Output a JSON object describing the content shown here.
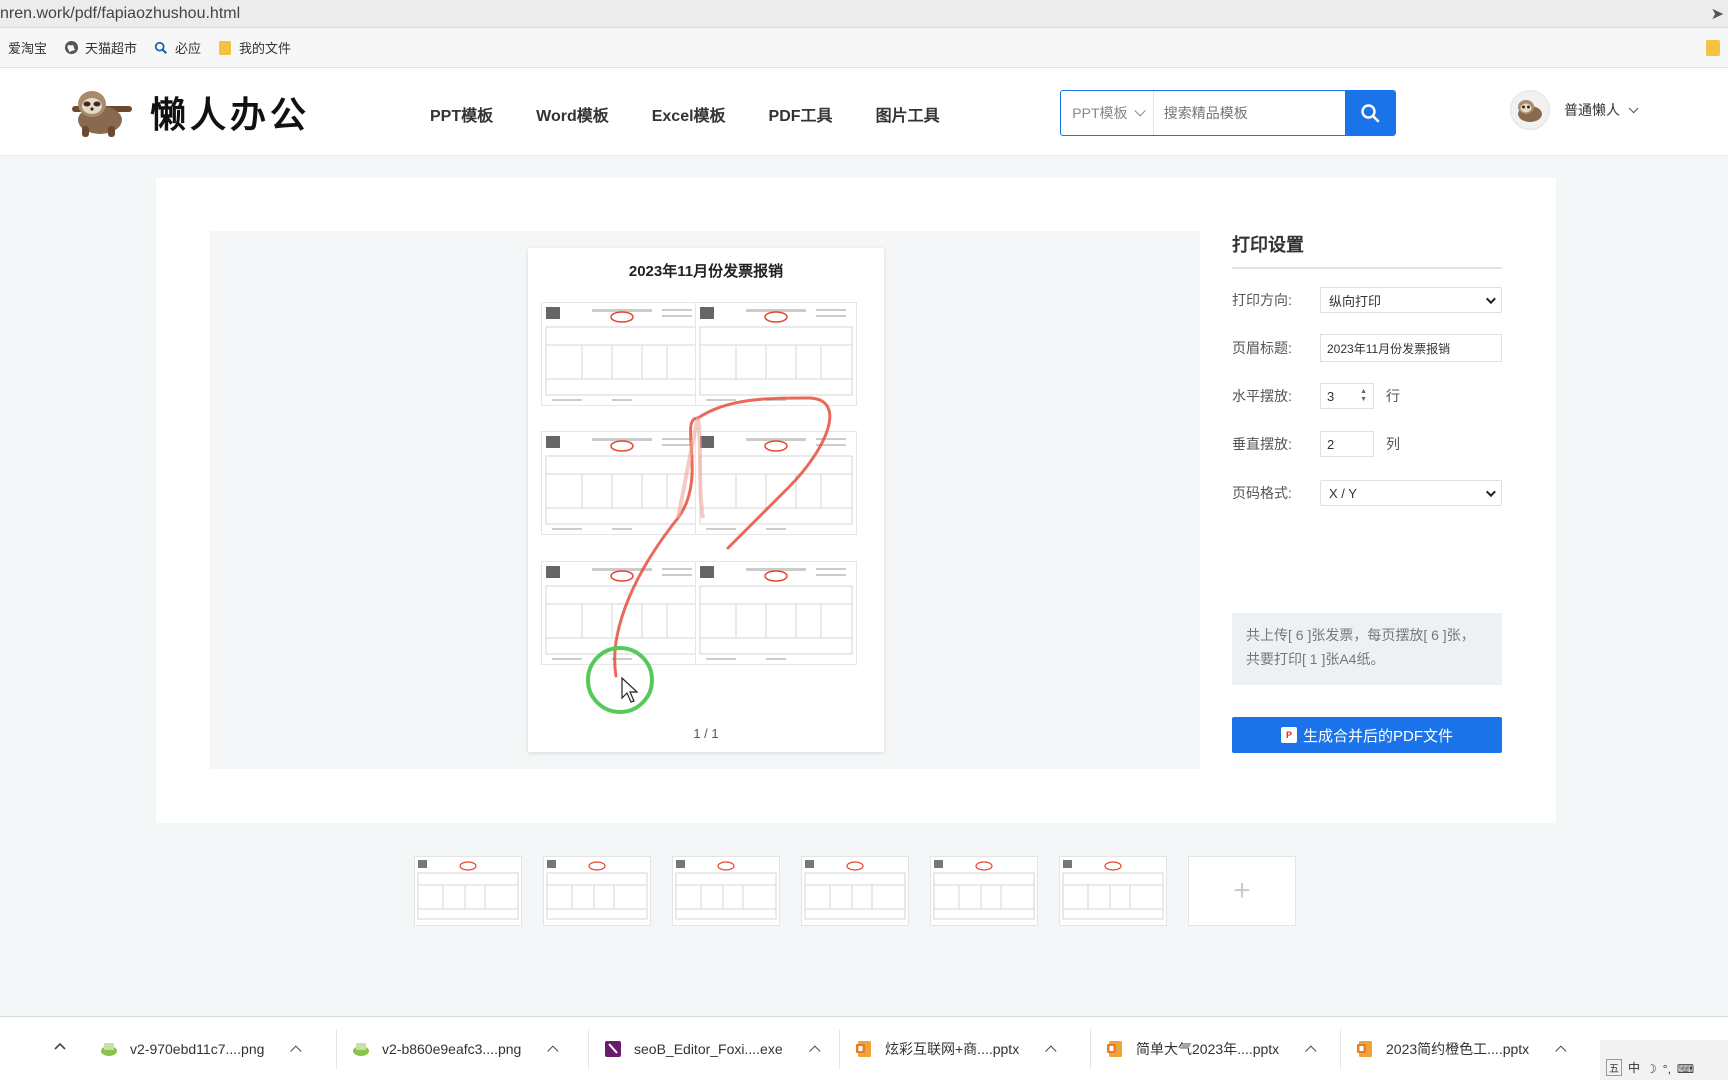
{
  "browser": {
    "url": "nren.work/pdf/fapiaozhushou.html",
    "bookmarks": [
      {
        "label": "爱淘宝",
        "icon": "none"
      },
      {
        "label": "天猫超市",
        "icon": "globe-icon"
      },
      {
        "label": "必应",
        "icon": "search-icon"
      },
      {
        "label": "我的文件",
        "icon": "folder-icon"
      }
    ]
  },
  "header": {
    "logo_text": "懒人办公",
    "nav": [
      "PPT模板",
      "Word模板",
      "Excel模板",
      "PDF工具",
      "图片工具"
    ],
    "search_category": "PPT模板",
    "search_placeholder": "搜索精品模板",
    "username": "普通懒人"
  },
  "preview": {
    "page_title": "2023年11月份发票报销",
    "page_number": "1 / 1"
  },
  "settings": {
    "title": "打印设置",
    "orientation_label": "打印方向:",
    "orientation_value": "纵向打印",
    "header_label": "页眉标题:",
    "header_value": "2023年11月份发票报销",
    "horizontal_label": "水平摆放:",
    "horizontal_value": "3",
    "horizontal_unit": "行",
    "vertical_label": "垂直摆放:",
    "vertical_value": "2",
    "vertical_unit": "列",
    "pagefmt_label": "页码格式:",
    "pagefmt_value": "X / Y",
    "info_text": "共上传[ 6 ]张发票，每页摆放[ 6 ]张，共要打印[ 1 ]张A4纸。",
    "generate_label": "生成合并后的PDF文件"
  },
  "thumbnails": {
    "count": 6,
    "add_symbol": "+"
  },
  "downloads": [
    {
      "name": "v2-970ebd11c7....png",
      "icon": "png-file-icon"
    },
    {
      "name": "v2-b860e9eafc3....png",
      "icon": "png-file-icon"
    },
    {
      "name": "seoB_Editor_Foxi....exe",
      "icon": "exe-file-icon"
    },
    {
      "name": "炫彩互联网+商....pptx",
      "icon": "pptx-file-icon"
    },
    {
      "name": "简单大气2023年....pptx",
      "icon": "pptx-file-icon"
    },
    {
      "name": "2023简约橙色工....pptx",
      "icon": "pptx-file-icon"
    }
  ],
  "tray": {
    "ime": "中"
  },
  "colors": {
    "accent": "#1a73e8",
    "annotation_red": "#e5452f",
    "annotation_green": "#55c95a"
  }
}
